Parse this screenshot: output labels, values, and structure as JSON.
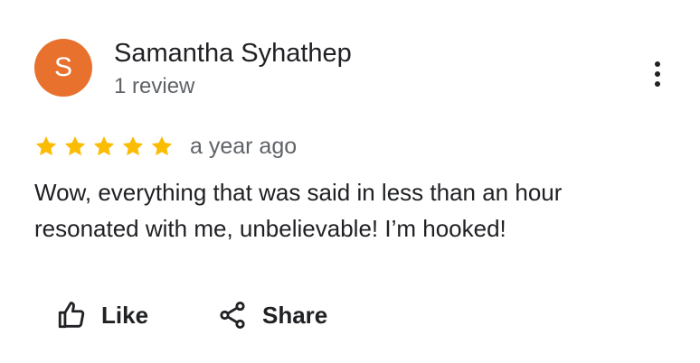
{
  "reviewer": {
    "avatar_initial": "S",
    "avatar_color": "#e8712e",
    "name": "Samantha Syhathep",
    "review_count": "1 review"
  },
  "review": {
    "rating": 5,
    "max_rating": 5,
    "star_color": "#fbbc04",
    "date": "a year ago",
    "text_lines": [
      "Wow, everything that was said in less than an hour",
      "resonated with me, unbelievable! I’m hooked!"
    ]
  },
  "actions": {
    "like_label": "Like",
    "like_icon": "thumbs-up-icon",
    "share_label": "Share",
    "share_icon": "share-icon",
    "more_icon": "more-vert-icon"
  }
}
